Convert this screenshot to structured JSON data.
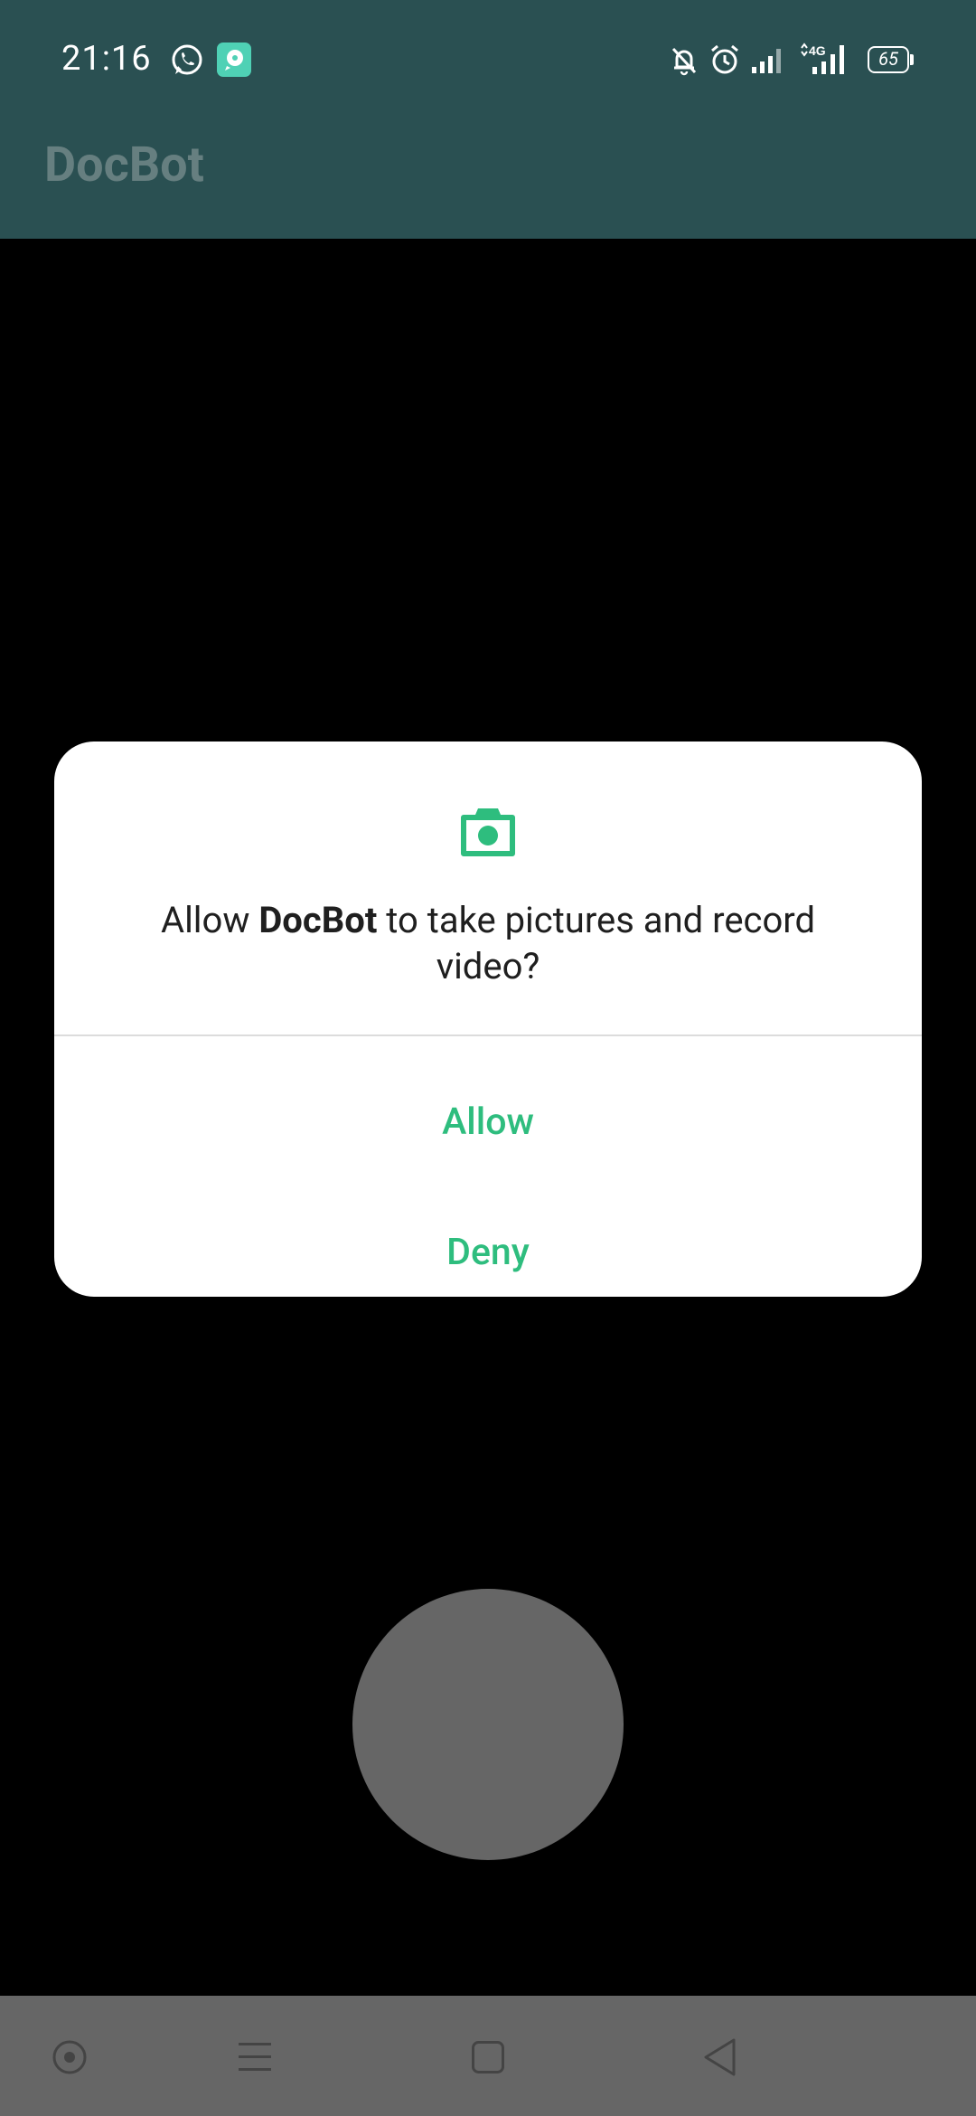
{
  "status_bar": {
    "time": "21:16",
    "battery_level": "65",
    "network_type": "4G",
    "icons": [
      "whatsapp-icon",
      "notification-app-icon",
      "bell-off-icon",
      "alarm-icon",
      "signal-icon",
      "mobile-data-signal-icon",
      "battery-icon"
    ]
  },
  "app_bar": {
    "title": "DocBot"
  },
  "dialog": {
    "icon": "camera-icon",
    "message_prefix": "Allow ",
    "app_name": "DocBot",
    "message_suffix": " to take pictures and record video?",
    "allow_label": "Allow",
    "deny_label": "Deny",
    "accent_color": "#2ebd7e"
  },
  "camera": {
    "capture_button": "capture-button"
  },
  "nav_bar": {
    "icons": [
      "assistant-icon",
      "menu-icon",
      "home-icon",
      "back-icon"
    ]
  },
  "colors": {
    "status_bar_bg": "#2a5052",
    "dialog_bg": "#ffffff",
    "scrim": "#000000",
    "nav_bar_bg": "#666666"
  }
}
